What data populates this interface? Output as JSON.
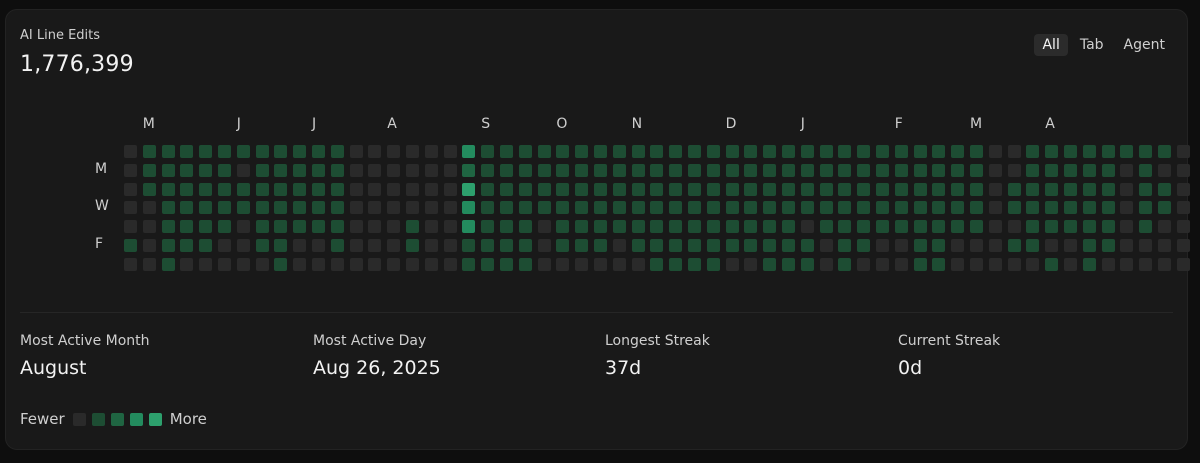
{
  "header": {
    "title": "AI Line Edits",
    "total": "1,776,399"
  },
  "tabs": [
    {
      "label": "All",
      "active": true
    },
    {
      "label": "Tab",
      "active": false
    },
    {
      "label": "Agent",
      "active": false
    }
  ],
  "heatmap": {
    "month_labels": [
      "M",
      "J",
      "J",
      "A",
      "S",
      "O",
      "N",
      "D",
      "J",
      "F",
      "M",
      "A"
    ],
    "day_labels": [
      "M",
      "W",
      "F"
    ],
    "levels_colors": [
      "#2a2a2a",
      "#1d4d33",
      "#1f6542",
      "#238b5e",
      "#2da06d"
    ],
    "weeks": [
      [
        0,
        0,
        0,
        0,
        0,
        1,
        0
      ],
      [
        1,
        1,
        1,
        0,
        0,
        0,
        0
      ],
      [
        1,
        1,
        1,
        1,
        1,
        1,
        1
      ],
      [
        1,
        1,
        1,
        1,
        1,
        1,
        0
      ],
      [
        1,
        1,
        1,
        1,
        1,
        1,
        0
      ],
      [
        1,
        1,
        1,
        1,
        1,
        0,
        0
      ],
      [
        1,
        0,
        1,
        1,
        0,
        0,
        0
      ],
      [
        1,
        1,
        1,
        1,
        1,
        1,
        0
      ],
      [
        1,
        1,
        1,
        1,
        1,
        1,
        1
      ],
      [
        1,
        1,
        1,
        1,
        1,
        0,
        0
      ],
      [
        1,
        1,
        1,
        1,
        1,
        0,
        0
      ],
      [
        1,
        1,
        1,
        1,
        1,
        1,
        0
      ],
      [
        0,
        0,
        0,
        0,
        0,
        0,
        0
      ],
      [
        0,
        0,
        0,
        0,
        0,
        0,
        0
      ],
      [
        0,
        0,
        0,
        0,
        0,
        0,
        0
      ],
      [
        0,
        0,
        0,
        0,
        1,
        1,
        0
      ],
      [
        0,
        0,
        0,
        0,
        0,
        0,
        0
      ],
      [
        0,
        0,
        0,
        0,
        0,
        0,
        0
      ],
      [
        3,
        2,
        4,
        3,
        3,
        1,
        1
      ],
      [
        1,
        1,
        1,
        1,
        1,
        1,
        1
      ],
      [
        1,
        1,
        1,
        1,
        1,
        1,
        1
      ],
      [
        1,
        1,
        1,
        1,
        1,
        1,
        1
      ],
      [
        1,
        1,
        1,
        1,
        0,
        0,
        0
      ],
      [
        1,
        1,
        1,
        1,
        1,
        1,
        0
      ],
      [
        1,
        1,
        1,
        1,
        1,
        1,
        0
      ],
      [
        1,
        1,
        1,
        1,
        1,
        1,
        0
      ],
      [
        1,
        1,
        1,
        1,
        1,
        0,
        0
      ],
      [
        1,
        1,
        1,
        1,
        1,
        1,
        0
      ],
      [
        1,
        1,
        1,
        1,
        1,
        1,
        1
      ],
      [
        1,
        1,
        1,
        1,
        1,
        1,
        1
      ],
      [
        1,
        1,
        1,
        1,
        1,
        1,
        1
      ],
      [
        1,
        1,
        1,
        1,
        1,
        1,
        1
      ],
      [
        1,
        1,
        1,
        1,
        1,
        1,
        0
      ],
      [
        1,
        1,
        1,
        1,
        1,
        1,
        0
      ],
      [
        1,
        1,
        1,
        1,
        1,
        1,
        1
      ],
      [
        1,
        1,
        1,
        1,
        1,
        1,
        1
      ],
      [
        1,
        1,
        1,
        1,
        0,
        1,
        1
      ],
      [
        1,
        1,
        1,
        1,
        1,
        0,
        0
      ],
      [
        1,
        1,
        1,
        1,
        1,
        1,
        1
      ],
      [
        1,
        1,
        1,
        1,
        1,
        1,
        0
      ],
      [
        1,
        1,
        1,
        1,
        1,
        0,
        0
      ],
      [
        1,
        1,
        1,
        1,
        1,
        0,
        0
      ],
      [
        1,
        1,
        1,
        1,
        1,
        1,
        1
      ],
      [
        1,
        1,
        1,
        1,
        1,
        1,
        1
      ],
      [
        1,
        1,
        1,
        1,
        1,
        0,
        0
      ],
      [
        1,
        1,
        1,
        1,
        1,
        0,
        0
      ],
      [
        0,
        0,
        0,
        0,
        0,
        0,
        0
      ],
      [
        0,
        0,
        1,
        1,
        0,
        1,
        0
      ],
      [
        1,
        1,
        1,
        1,
        1,
        1,
        0
      ],
      [
        1,
        1,
        1,
        1,
        1,
        0,
        1
      ],
      [
        1,
        1,
        1,
        1,
        1,
        0,
        0
      ],
      [
        1,
        1,
        1,
        1,
        1,
        1,
        1
      ],
      [
        1,
        1,
        1,
        1,
        1,
        1,
        0
      ],
      [
        1,
        0,
        0,
        0,
        0,
        0,
        0
      ],
      [
        1,
        1,
        1,
        1,
        1,
        0,
        0
      ],
      [
        1,
        0,
        1,
        1,
        0,
        0,
        0
      ],
      [
        0,
        0,
        0,
        0,
        0,
        0,
        0
      ]
    ]
  },
  "stats": [
    {
      "label": "Most Active Month",
      "value": "August"
    },
    {
      "label": "Most Active Day",
      "value": "Aug 26, 2025"
    },
    {
      "label": "Longest Streak",
      "value": "37d"
    },
    {
      "label": "Current Streak",
      "value": "0d"
    }
  ],
  "legend": {
    "fewer_label": "Fewer",
    "more_label": "More"
  }
}
